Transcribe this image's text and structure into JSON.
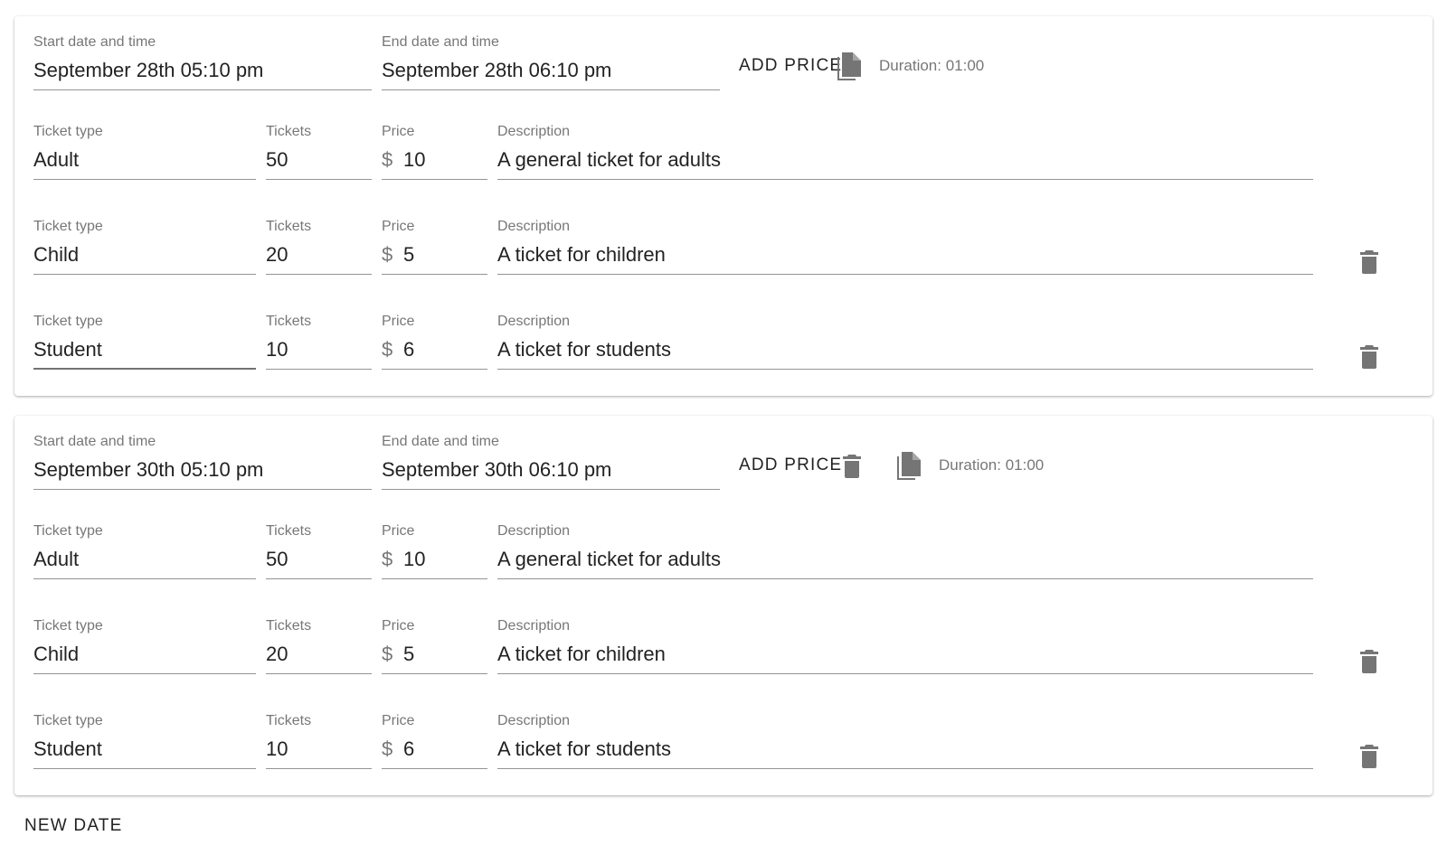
{
  "labels": {
    "start": "Start date and time",
    "end": "End date and time",
    "ticket_type": "Ticket type",
    "tickets": "Tickets",
    "price": "Price",
    "description": "Description",
    "currency": "$"
  },
  "dates": [
    {
      "start": "September 28th 05:10 pm",
      "end": "September 28th 06:10 pm",
      "add_price_label": "ADD PRICE",
      "duration": "Duration: 01:00",
      "prices": [
        {
          "type": "Adult",
          "tickets": "50",
          "price": "10",
          "description": "A general ticket for adults"
        },
        {
          "type": "Child",
          "tickets": "20",
          "price": "5",
          "description": "A ticket for children"
        },
        {
          "type": "Student",
          "tickets": "10",
          "price": "6",
          "description": "A ticket for students"
        }
      ]
    },
    {
      "start": "September 30th 05:10 pm",
      "end": "September 30th 06:10 pm",
      "add_price_label": "ADD PRICE",
      "duration": "Duration: 01:00",
      "prices": [
        {
          "type": "Adult",
          "tickets": "50",
          "price": "10",
          "description": "A general ticket for adults"
        },
        {
          "type": "Child",
          "tickets": "20",
          "price": "5",
          "description": "A ticket for children"
        },
        {
          "type": "Student",
          "tickets": "10",
          "price": "6",
          "description": "A ticket for students"
        }
      ]
    }
  ],
  "new_date_label": "NEW DATE",
  "icons": {
    "copy": "copy-icon",
    "delete": "delete-icon"
  },
  "colors": {
    "icon": "#757575",
    "underline": "#9e9e9e"
  }
}
